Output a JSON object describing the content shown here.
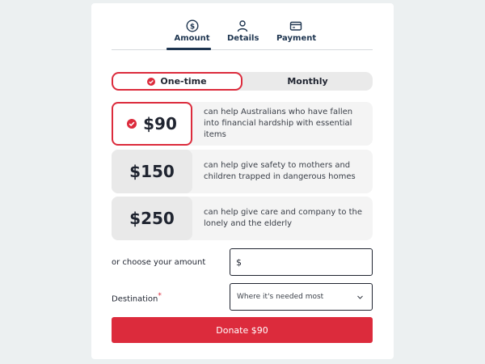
{
  "steps": [
    {
      "label": "Amount",
      "icon": "dollar-circle-icon"
    },
    {
      "label": "Details",
      "icon": "person-icon"
    },
    {
      "label": "Payment",
      "icon": "credit-card-icon"
    }
  ],
  "frequency": {
    "one_time_label": "One-time",
    "monthly_label": "Monthly",
    "selected": "one-time"
  },
  "options": [
    {
      "amount": "$90",
      "description": "can help Australians who have fallen into financial hardship with essential items",
      "selected": true
    },
    {
      "amount": "$150",
      "description": "can help give safety to mothers and children trapped in dangerous homes",
      "selected": false
    },
    {
      "amount": "$250",
      "description": "can help give care and company to the lonely and the elderly",
      "selected": false
    }
  ],
  "custom_amount": {
    "label": "or choose your amount",
    "currency_symbol": "$",
    "value": ""
  },
  "destination": {
    "label": "Destination",
    "required_mark": "*",
    "selected_value": "Where it's needed most"
  },
  "donate_button": {
    "label": "Donate $90"
  },
  "colors": {
    "accent": "#dc2b3c",
    "navy": "#1e3550",
    "background": "#ecf0f1"
  }
}
